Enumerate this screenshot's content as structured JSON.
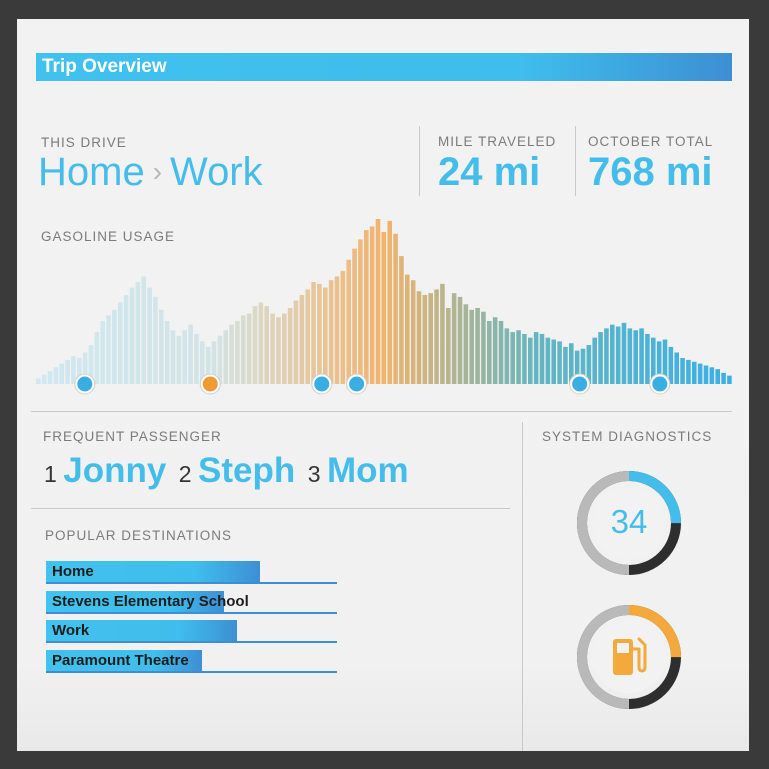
{
  "header": {
    "title": "Trip Overview"
  },
  "this_drive": {
    "label": "THIS DRIVE",
    "from": "Home",
    "separator": "›",
    "to": "Work"
  },
  "mile_traveled": {
    "label": "MILE TRAVELED",
    "value": "24 mi"
  },
  "october_total": {
    "label": "OCTOBER TOTAL",
    "value": "768 mi"
  },
  "chart_data": {
    "type": "bar",
    "title": "GASOLINE USAGE",
    "values": [
      6,
      10,
      14,
      18,
      22,
      26,
      30,
      28,
      34,
      42,
      56,
      68,
      74,
      80,
      88,
      96,
      104,
      110,
      116,
      104,
      94,
      80,
      68,
      58,
      52,
      58,
      64,
      54,
      46,
      40,
      46,
      52,
      58,
      64,
      68,
      74,
      76,
      84,
      88,
      84,
      76,
      72,
      76,
      82,
      90,
      96,
      102,
      110,
      108,
      104,
      112,
      116,
      122,
      134,
      146,
      156,
      166,
      170,
      178,
      164,
      176,
      162,
      138,
      118,
      112,
      100,
      96,
      98,
      102,
      108,
      82,
      98,
      94,
      86,
      80,
      82,
      78,
      68,
      72,
      68,
      60,
      56,
      58,
      54,
      50,
      56,
      54,
      50,
      48,
      46,
      40,
      44,
      36,
      38,
      42,
      50,
      56,
      60,
      64,
      62,
      66,
      60,
      58,
      60,
      54,
      50,
      46,
      48,
      40,
      34,
      28,
      26,
      24,
      22,
      20,
      18,
      16,
      12,
      9
    ],
    "palette_stops": [
      "#cfe8f2",
      "#d2e4e6",
      "#f3b36b",
      "#65b5c0",
      "#3bb0e6"
    ],
    "markers": [
      {
        "position": 0.07,
        "color": "#3aade3"
      },
      {
        "position": 0.25,
        "color": "#ee9b36"
      },
      {
        "position": 0.41,
        "color": "#3aade3"
      },
      {
        "position": 0.46,
        "color": "#3aade3"
      },
      {
        "position": 0.78,
        "color": "#3aade3"
      },
      {
        "position": 0.895,
        "color": "#3aade3"
      }
    ]
  },
  "frequent_passenger": {
    "label": "FREQUENT PASSENGER",
    "items": [
      {
        "rank": "1",
        "name": "Jonny"
      },
      {
        "rank": "2",
        "name": "Steph"
      },
      {
        "rank": "3",
        "name": "Mom"
      }
    ]
  },
  "popular_destinations": {
    "label": "POPULAR DESTINATIONS",
    "items": [
      {
        "name": "Home",
        "share": 0.735
      },
      {
        "name": "Stevens Elementary School",
        "share": 0.61
      },
      {
        "name": "Work",
        "share": 0.655
      },
      {
        "name": "Paramount Theatre",
        "share": 0.535
      }
    ]
  },
  "system_diagnostics": {
    "label": "SYSTEM DIAGNOSTICS",
    "gauge1": {
      "value": "34",
      "fraction": 0.25,
      "color": "#45bdea"
    },
    "gauge2": {
      "icon": "fuel-pump-icon",
      "fraction": 0.25,
      "color": "#f3a93b"
    }
  },
  "colors": {
    "accent": "#45bdea",
    "orange": "#f3a93b",
    "dark": "#3a3a3a"
  }
}
